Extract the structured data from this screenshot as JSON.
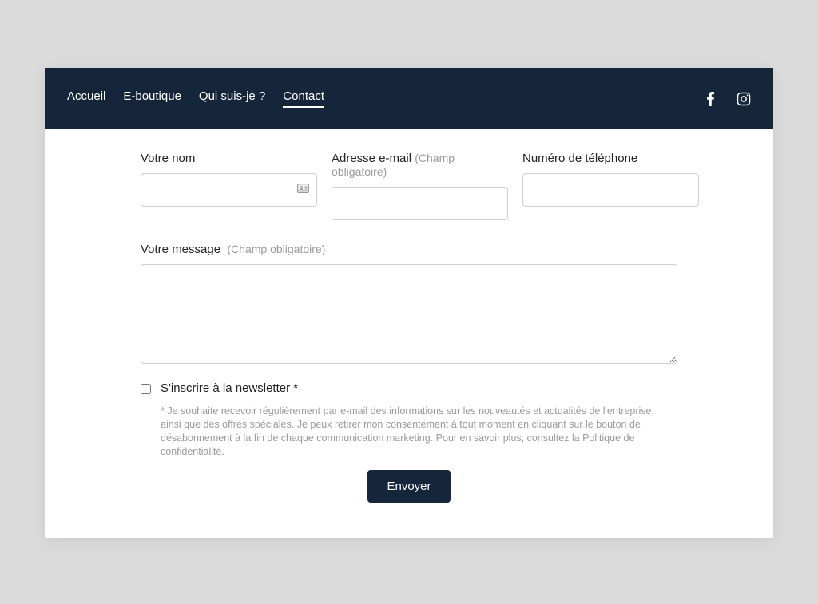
{
  "nav": {
    "items": [
      {
        "label": "Accueil",
        "active": false
      },
      {
        "label": "E-boutique",
        "active": false
      },
      {
        "label": "Qui suis-je ?",
        "active": false
      },
      {
        "label": "Contact",
        "active": true
      }
    ]
  },
  "form": {
    "name_label": "Votre nom",
    "email_label": "Adresse e-mail",
    "email_required": "(Champ obligatoire)",
    "phone_label": "Numéro de téléphone",
    "message_label": "Votre message",
    "message_required": "(Champ obligatoire)",
    "newsletter_label": "S'inscrire à la newsletter *",
    "disclaimer": "* Je souhaite recevoir régulièrement par e-mail des informations sur les nouveautés et actualités de l'entreprise, ainsi que des offres spéciales. Je peux retirer mon consentement à tout moment en cliquant sur le bouton de désabonnement à la fin de chaque communication marketing. Pour en savoir plus, consultez la Politique de confidentialité.",
    "submit": "Envoyer"
  }
}
